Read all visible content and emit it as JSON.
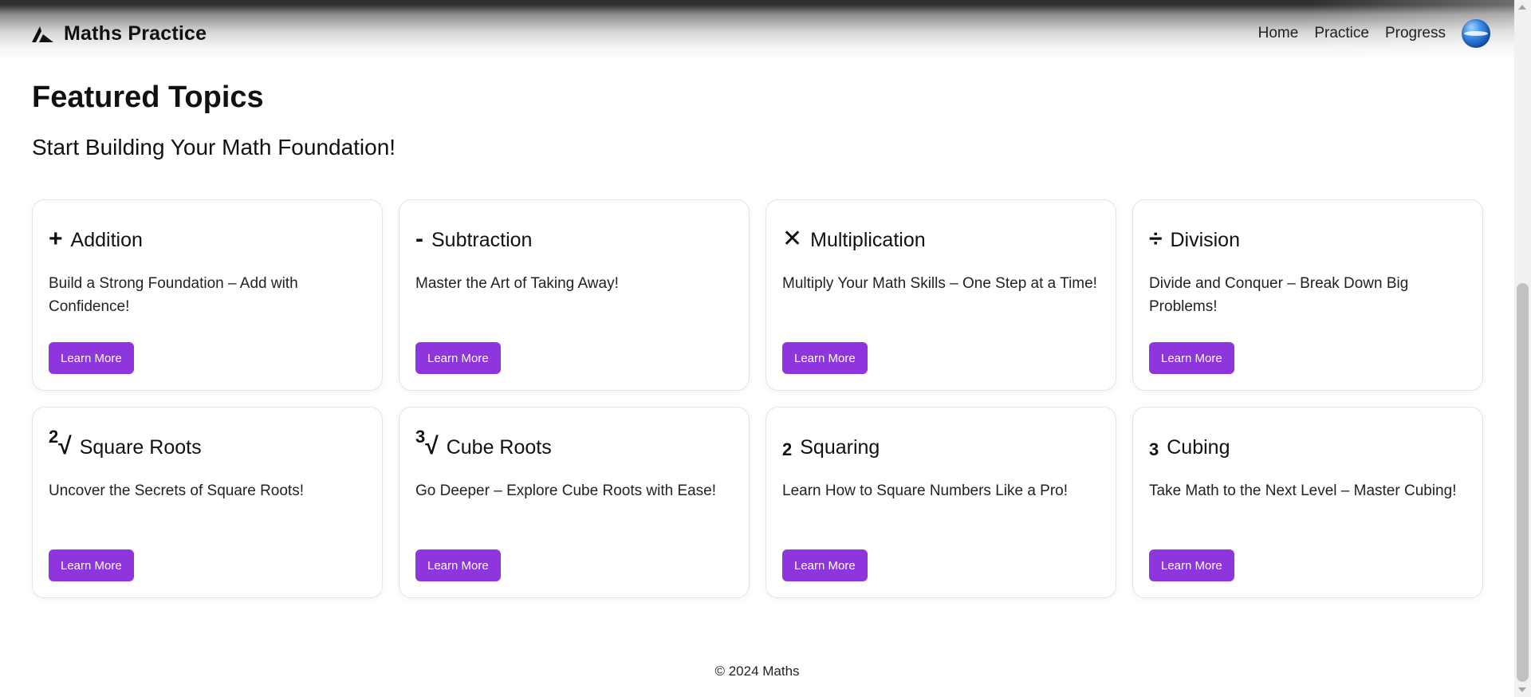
{
  "header": {
    "brand_name": "Maths Practice",
    "brand_icon": "mountain-logo-icon",
    "nav": [
      {
        "label": "Home"
      },
      {
        "label": "Practice"
      },
      {
        "label": "Progress"
      }
    ],
    "avatar_icon": "globe-avatar-icon"
  },
  "main": {
    "title": "Featured Topics",
    "subtitle": "Start Building Your Math Foundation!",
    "topics": [
      {
        "symbol": "+",
        "symbol_sup": "",
        "title": "Addition",
        "description": "Build a Strong Foundation – Add with Confidence!",
        "button": "Learn More"
      },
      {
        "symbol": "-",
        "symbol_sup": "",
        "title": "Subtraction",
        "description": "Master the Art of Taking Away!",
        "button": "Learn More"
      },
      {
        "symbol": "✕",
        "symbol_sup": "",
        "title": "Multiplication",
        "description": "Multiply Your Math Skills – One Step at a Time!",
        "button": "Learn More"
      },
      {
        "symbol": "÷",
        "symbol_sup": "",
        "title": "Division",
        "description": "Divide and Conquer – Break Down Big Problems!",
        "button": "Learn More"
      },
      {
        "symbol": "√",
        "symbol_sup": "2",
        "title": "Square Roots",
        "description": "Uncover the Secrets of Square Roots!",
        "button": "Learn More"
      },
      {
        "symbol": "√",
        "symbol_sup": "3",
        "title": "Cube Roots",
        "description": "Go Deeper – Explore Cube Roots with Ease!",
        "button": "Learn More"
      },
      {
        "symbol": "",
        "symbol_sup": "2",
        "title": "Squaring",
        "description": "Learn How to Square Numbers Like a Pro!",
        "button": "Learn More"
      },
      {
        "symbol": "",
        "symbol_sup": "3",
        "title": "Cubing",
        "description": "Take Math to the Next Level – Master Cubing!",
        "button": "Learn More"
      }
    ]
  },
  "footer": {
    "text": "© 2024 Maths"
  },
  "colors": {
    "button_bg": "#8e35de",
    "button_text": "#ffffff"
  }
}
